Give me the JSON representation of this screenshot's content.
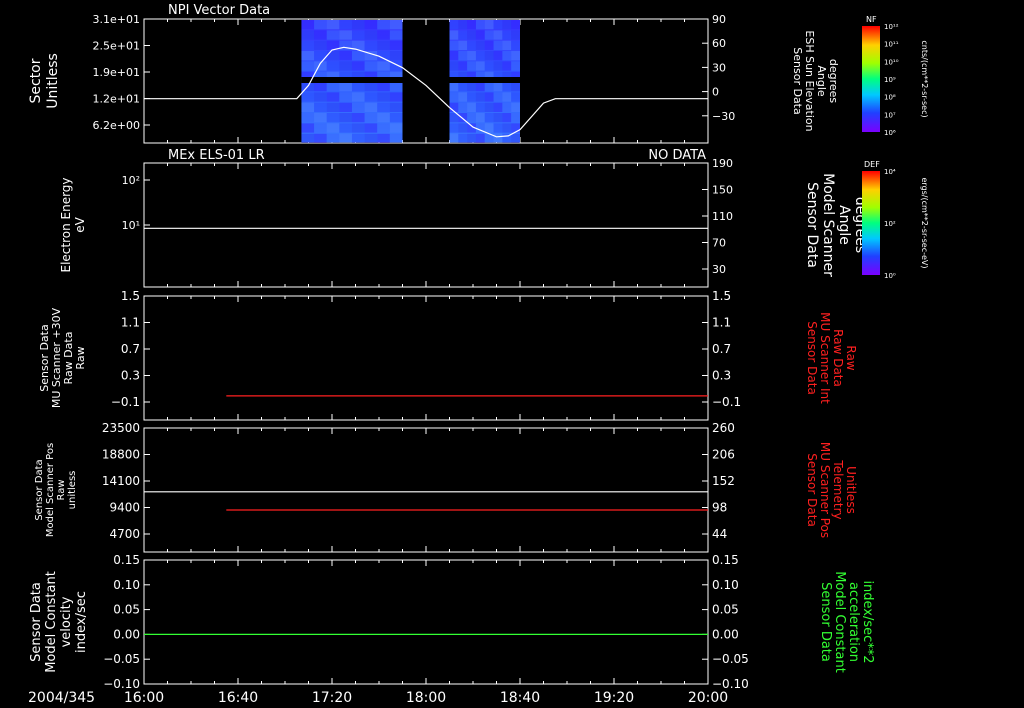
{
  "footer": {
    "date": "2004/345"
  },
  "x_ticks": [
    "16:00",
    "16:40",
    "17:20",
    "18:00",
    "18:40",
    "19:20",
    "20:00"
  ],
  "colors": {
    "white": "#ffffff",
    "red": "#ff2020",
    "green": "#33ff33",
    "bg": "#000000"
  },
  "colorbars": [
    {
      "label": "NF",
      "unit": "cnts/(cm**2-sr-sec)",
      "ticks": [
        "10¹²",
        "10¹¹",
        "10¹⁰",
        "10⁹",
        "10⁸",
        "10⁷",
        "10⁶"
      ]
    },
    {
      "label": "DEF",
      "unit": "ergs/(cm**2-sr-sec-eV)",
      "ticks": [
        "10⁴",
        "10²",
        "10⁰"
      ]
    }
  ],
  "chart_data": [
    {
      "type": "heatmap",
      "title": "NPI Vector Data",
      "note": "",
      "ylabel": [
        "Sector",
        "Unitless"
      ],
      "yticks": [
        "3.1e+01",
        "2.5e+01",
        "1.9e+01",
        "1.2e+01",
        "6.2e+00"
      ],
      "y2label": [
        "Sensor Data",
        "ESH Sun Elevation",
        "Angle",
        "degrees"
      ],
      "y2label_color": "#ffffff",
      "y2ticks": [
        "90",
        "60",
        "30",
        "0",
        "−30"
      ],
      "y2lim": [
        -50,
        90
      ],
      "data_blocks": [
        [
          "17:07",
          "17:50"
        ],
        [
          "18:10",
          "18:40"
        ]
      ],
      "series": [
        {
          "points": [
            [
              "16:00",
              0
            ],
            [
              "17:05",
              0
            ],
            [
              "17:10",
              15
            ],
            [
              "17:15",
              40
            ],
            [
              "17:20",
              55
            ],
            [
              "17:25",
              58
            ],
            [
              "17:30",
              56
            ],
            [
              "17:40",
              48
            ],
            [
              "17:50",
              35
            ],
            [
              "18:00",
              15
            ],
            [
              "18:10",
              -10
            ],
            [
              "18:20",
              -32
            ],
            [
              "18:30",
              -43
            ],
            [
              "18:35",
              -42
            ],
            [
              "18:40",
              -35
            ],
            [
              "18:45",
              -20
            ],
            [
              "18:50",
              -5
            ],
            [
              "18:55",
              0
            ],
            [
              "20:00",
              0
            ]
          ]
        }
      ]
    },
    {
      "type": "line",
      "title": "MEx ELS-01 LR",
      "note": "NO DATA",
      "ylabel": [
        "Electron Energy",
        "eV"
      ],
      "yticks": [
        "10²",
        "10¹"
      ],
      "y2label": [
        "Sensor Data",
        "Model Scanner",
        "Angle",
        "degrees"
      ],
      "y2label_color": "#ffffff",
      "y2ticks": [
        "190",
        "150",
        "110",
        "70",
        "30"
      ],
      "y2lim": [
        0,
        190
      ],
      "series": [
        {
          "points": [
            [
              "16:00",
              90
            ],
            [
              "20:00",
              90
            ]
          ]
        }
      ]
    },
    {
      "type": "line",
      "title": "",
      "note": "",
      "ylabel": [
        "Sensor Data",
        "MU Scanner +30V",
        "Raw Data",
        "Raw"
      ],
      "yticks": [
        "1.5",
        "1.1",
        "0.7",
        "0.3",
        "−0.1"
      ],
      "ylim": [
        -0.4,
        1.5
      ],
      "y2label": [
        "Sensor Data",
        "MU Scanner Int",
        "Raw Data",
        "Raw"
      ],
      "y2label_color": "#ff2020",
      "y2ticks": [
        "1.5",
        "1.1",
        "0.7",
        "0.3",
        "−0.1"
      ],
      "series": [
        {
          "points": [
            [
              "16:35",
              -0.03
            ],
            [
              "20:00",
              -0.03
            ]
          ]
        }
      ]
    },
    {
      "type": "line",
      "title": "",
      "note": "",
      "ylabel": [
        "Sensor Data",
        "Model Scanner Pos",
        "Raw",
        "unitless"
      ],
      "yticks": [
        "23500",
        "18800",
        "14100",
        "9400",
        "4700"
      ],
      "ylim": [
        0,
        23500
      ],
      "y2label": [
        "Sensor Data",
        "MU Scanner Pos",
        "Telemetry",
        "Unitless"
      ],
      "y2label_color": "#ff2020",
      "y2ticks": [
        "260",
        "206",
        "152",
        "98",
        "44"
      ],
      "y2lim": [
        0,
        260
      ],
      "series": [
        {
          "axis": "left",
          "points": [
            [
              "16:00",
              11400
            ],
            [
              "20:00",
              11400
            ]
          ]
        },
        {
          "axis": "right",
          "points": [
            [
              "16:35",
              88
            ],
            [
              "20:00",
              88
            ]
          ]
        }
      ]
    },
    {
      "type": "line",
      "title": "",
      "note": "",
      "ylabel": [
        "Sensor Data",
        "Model Constant",
        "velocity",
        "index/sec"
      ],
      "yticks": [
        "0.15",
        "0.10",
        "0.05",
        "0.00",
        "−0.05",
        "−0.10"
      ],
      "ylim": [
        -0.1,
        0.15
      ],
      "y2label": [
        "Sensor Data",
        "Model Constant",
        "acceleration",
        "index/sec**2"
      ],
      "y2label_color": "#33ff33",
      "y2ticks": [
        "0.15",
        "0.10",
        "0.05",
        "0.00",
        "−0.05",
        "−0.10"
      ],
      "series": [
        {
          "points": [
            [
              "16:00",
              0
            ],
            [
              "20:00",
              0
            ]
          ]
        }
      ]
    }
  ]
}
